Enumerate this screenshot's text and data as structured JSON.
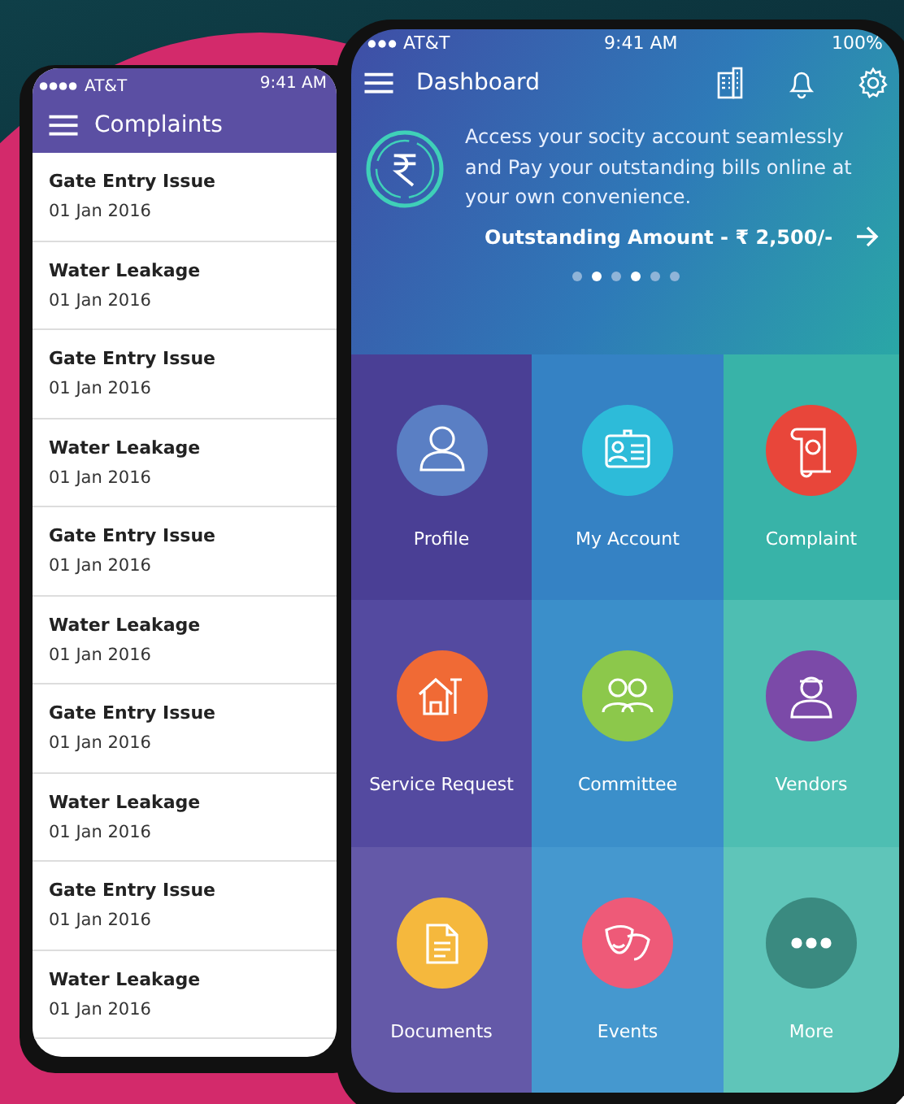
{
  "complaints_phone": {
    "status_bar": {
      "carrier": "AT&T",
      "time": "9:41 AM"
    },
    "title": "Complaints",
    "items": [
      {
        "title": "Gate Entry Issue",
        "date": "01 Jan 2016"
      },
      {
        "title": "Water Leakage",
        "date": "01 Jan 2016"
      },
      {
        "title": "Gate Entry Issue",
        "date": "01 Jan 2016"
      },
      {
        "title": "Water Leakage",
        "date": "01 Jan 2016"
      },
      {
        "title": "Gate Entry Issue",
        "date": "01 Jan 2016"
      },
      {
        "title": "Water Leakage",
        "date": "01 Jan 2016"
      },
      {
        "title": "Gate Entry Issue",
        "date": "01 Jan 2016"
      },
      {
        "title": "Water Leakage",
        "date": "01 Jan 2016"
      },
      {
        "title": "Gate Entry Issue",
        "date": "01 Jan 2016"
      },
      {
        "title": "Water Leakage",
        "date": "01 Jan 2016"
      }
    ]
  },
  "dashboard_phone": {
    "status_bar": {
      "carrier": "AT&T",
      "time": "9:41 AM",
      "battery": "100%"
    },
    "title": "Dashboard",
    "banner": {
      "message": "Access your socity account seamlessly and Pay your outstanding bills online at your own convenience.",
      "amount": "Outstanding Amount - ₹ 2,500/-",
      "dots": [
        {
          "selected": false
        },
        {
          "selected": true
        },
        {
          "selected": false
        },
        {
          "selected": true
        },
        {
          "selected": false
        },
        {
          "selected": false
        }
      ]
    },
    "tiles": [
      {
        "label": "Profile",
        "color": "#5a7fc4"
      },
      {
        "label": "My Account",
        "color": "#2dbbd9"
      },
      {
        "label": "Complaint",
        "color": "#e8463a"
      },
      {
        "label": "Service Request",
        "color": "#f06a35"
      },
      {
        "label": "Committee",
        "color": "#8cc84b"
      },
      {
        "label": "Vendors",
        "color": "#7b4aa8"
      },
      {
        "label": "Documents",
        "color": "#f5b83d"
      },
      {
        "label": "Events",
        "color": "#ee5a78"
      },
      {
        "label": "More",
        "color": "#3a8a80"
      }
    ]
  }
}
